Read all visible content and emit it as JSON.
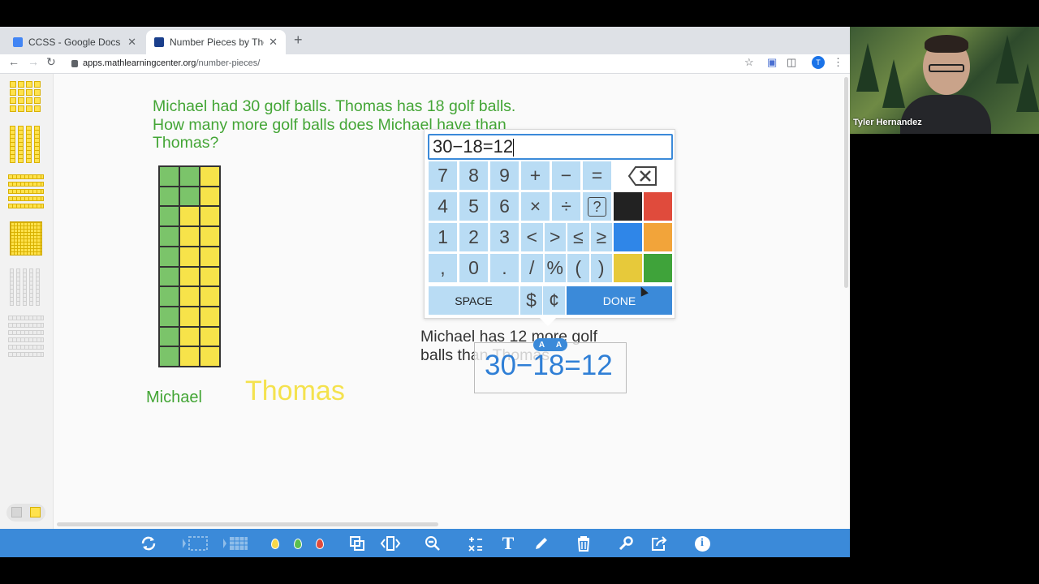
{
  "browser": {
    "tabs": [
      {
        "title": "CCSS - Google Docs",
        "active": false,
        "favicon_color": "#4285f4"
      },
      {
        "title": "Number Pieces by The Math Le",
        "active": true,
        "favicon_color": "#1a3f8c"
      }
    ],
    "new_tab_label": "+",
    "url_host": "apps.mathlearningcenter.org",
    "url_path": "/number-pieces/",
    "profile_initial": "T"
  },
  "app": {
    "problem_text": "Michael had 30 golf balls. Thomas has 18 golf balls. How many more golf balls does Michael have than Thomas?",
    "label_michael": "Michael",
    "label_thomas": "Thomas",
    "answer_text": "Michael has 12 more golf balls than Thomas.",
    "expression_display": "30−18=12",
    "font_size_buttons": [
      "A",
      "A"
    ],
    "ten_rod": {
      "green_cells": 10,
      "yellow_cells": 20,
      "green_rows_in_middle_column": 2
    }
  },
  "keypad": {
    "input_value": "30−18=12",
    "rows": [
      [
        "7",
        "8",
        "9",
        "+",
        "−",
        "="
      ],
      [
        "4",
        "5",
        "6",
        "×",
        "÷",
        "?"
      ],
      [
        "1",
        "2",
        "3",
        "<",
        ">",
        "≤",
        "≥"
      ],
      [
        ",",
        "0",
        ".",
        "/",
        "%",
        "(",
        ")"
      ]
    ],
    "backspace_icon": "backspace-icon",
    "colors": [
      "#222222",
      "#e04b3c",
      "#2f86e8",
      "#f2a43a",
      "#e7c93a",
      "#3fa33a"
    ],
    "space_label": "SPACE",
    "currency": [
      "$",
      "¢"
    ],
    "done_label": "DONE"
  },
  "bottom_toolbar": {
    "icons": [
      "refresh-icon",
      "grid-left-icon",
      "grid-right-icon",
      "ink-yellow-icon",
      "ink-green-icon",
      "ink-red-icon",
      "duplicate-icon",
      "flip-icon",
      "zoom-out-icon",
      "equation-icon",
      "text-icon",
      "pencil-icon",
      "trash-icon",
      "tools-icon",
      "share-icon",
      "info-icon"
    ],
    "text_tool_label": "T",
    "info_label": "i"
  },
  "video": {
    "participant_name": "Tyler Hernandez"
  }
}
